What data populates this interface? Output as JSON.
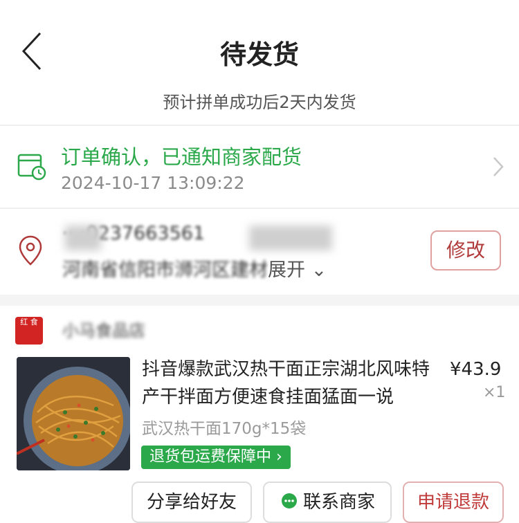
{
  "header": {
    "title": "待发货",
    "subtitle": "预计拼单成功后2天内发货"
  },
  "status": {
    "text": "订单确认，已通知商家配货",
    "time": "2024-10-17 13:09:22"
  },
  "address": {
    "line1": "·· ·0237663561",
    "line2_start": "河南省信阳市",
    "line2_blurred": "浉河区",
    "line2_end": "建材",
    "expand": "展开",
    "modify": "修改"
  },
  "shop": {
    "logo_text": "红 食",
    "name": "小马食品店"
  },
  "product": {
    "title": "抖音爆款武汉热干面正宗湖北风味特产干拌面方便速食挂面猛面一说",
    "price": "¥43.9",
    "qty": "×1",
    "spec": "武汉热干面170g*15袋",
    "badge": "退货包运费保障中"
  },
  "actions": {
    "share": "分享给好友",
    "contact": "联系商家",
    "refund": "申请退款"
  },
  "colors": {
    "green": "#2aa84a",
    "red": "#c03a3a"
  }
}
